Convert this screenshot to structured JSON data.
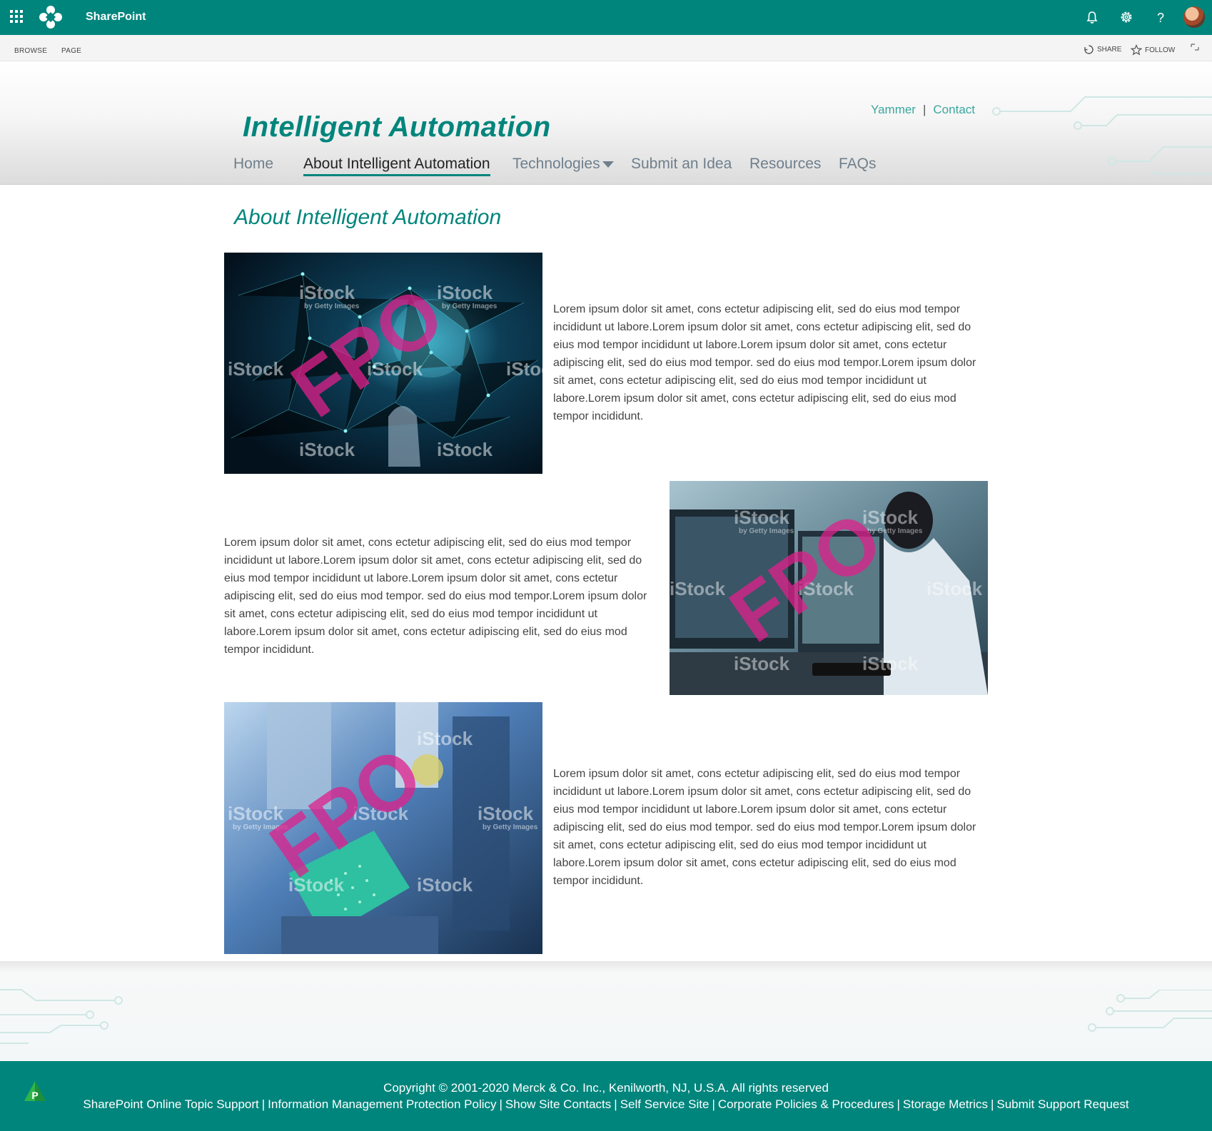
{
  "suite": {
    "app_name": "SharePoint"
  },
  "ribbon": {
    "tabs": [
      "BROWSE",
      "PAGE"
    ],
    "share_label": "SHARE",
    "follow_label": "FOLLOW"
  },
  "header": {
    "site_title": "Intelligent Automation",
    "top_links": [
      "Yammer",
      "Contact"
    ],
    "nav": [
      "Home",
      "About Intelligent Automation",
      "Technologies",
      "Submit an Idea",
      "Resources",
      "FAQs"
    ],
    "active_nav": "About Intelligent Automation"
  },
  "main": {
    "page_title": "About Intelligent Automation",
    "sections": [
      {
        "image_watermarks": [
          "iStock",
          "by Getty Images",
          "FPO"
        ],
        "text": "Lorem ipsum dolor sit amet, cons ectetur adipiscing elit, sed do eius mod tempor incididunt ut labore.Lorem ipsum dolor sit amet, cons ectetur adipiscing elit, sed do eius mod tempor incididunt ut labore.Lorem ipsum dolor sit amet, cons ectetur adipiscing elit, sed do eius mod tempor. sed do eius mod tempor.Lorem ipsum dolor sit amet, cons ectetur adipiscing elit, sed do eius mod tempor incididunt ut labore.Lorem ipsum dolor sit amet, cons ectetur adipiscing elit, sed do eius mod tempor incididunt."
      },
      {
        "image_watermarks": [
          "iStock",
          "by Getty Images",
          "FPO"
        ],
        "text": "Lorem ipsum dolor sit amet, cons ectetur adipiscing elit, sed do eius mod tempor incididunt ut labore.Lorem ipsum dolor sit amet, cons ectetur adipiscing elit, sed do eius mod tempor incididunt ut labore.Lorem ipsum dolor sit amet, cons ectetur adipiscing elit, sed do eius mod tempor. sed do eius mod tempor.Lorem ipsum dolor sit amet, cons ectetur adipiscing elit, sed do eius mod tempor incididunt ut labore.Lorem ipsum dolor sit amet, cons ectetur adipiscing elit, sed do eius mod tempor incididunt."
      },
      {
        "image_watermarks": [
          "iStock",
          "by Getty Images",
          "FPO"
        ],
        "text": "Lorem ipsum dolor sit amet, cons ectetur adipiscing elit, sed do eius mod tempor incididunt ut labore.Lorem ipsum dolor sit amet, cons ectetur adipiscing elit, sed do eius mod tempor incididunt ut labore.Lorem ipsum dolor sit amet, cons ectetur adipiscing elit, sed do eius mod tempor. sed do eius mod tempor.Lorem ipsum dolor sit amet, cons ectetur adipiscing elit, sed do eius mod tempor incididunt ut labore.Lorem ipsum dolor sit amet, cons ectetur adipiscing elit, sed do eius mod tempor incididunt."
      }
    ]
  },
  "footer": {
    "copyright": "Copyright © 2001-2020 Merck & Co. Inc., Kenilworth, NJ, U.S.A. All rights reserved",
    "links": [
      "SharePoint Online Topic Support",
      "Information Management Protection Policy",
      "Show Site Contacts",
      "Self Service Site",
      "Corporate Policies & Procedures",
      "Storage Metrics",
      "Submit Support Request"
    ],
    "separator": "|",
    "badge_letter": "P"
  },
  "colors": {
    "brand": "#00857c",
    "link": "#3aa79f",
    "nav": "#6f7f8c",
    "fpo": "#e0208c"
  },
  "icons": [
    "app-launcher-icon",
    "merck-logo-icon",
    "bell-icon",
    "gear-icon",
    "help-icon",
    "share-icon",
    "star-icon",
    "focus-mode-icon"
  ]
}
